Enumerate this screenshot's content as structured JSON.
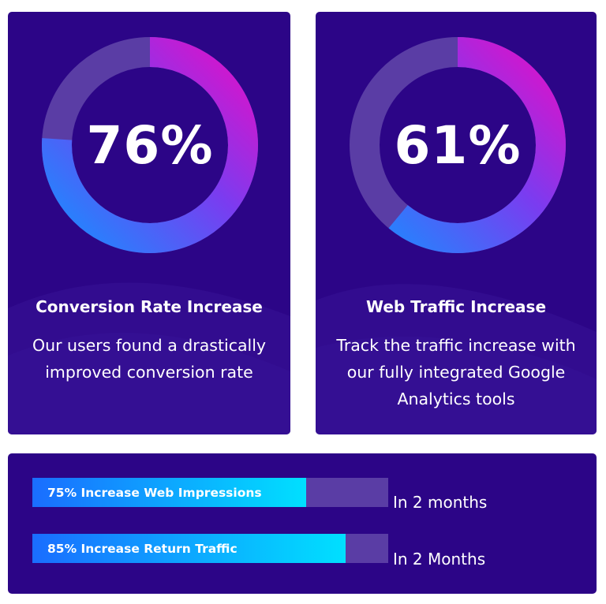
{
  "stats": [
    {
      "value_text": "76%",
      "percent": 76,
      "title": "Conversion Rate Increase",
      "description": "Our users found a drastically improved conversion rate"
    },
    {
      "value_text": "61%",
      "percent": 61,
      "title": "Web Traffic Increase",
      "description": "Track the traffic increase with our fully integrated Google Analytics tools"
    }
  ],
  "progress": [
    {
      "label": "75% Increase Web Impressions",
      "percent": 75,
      "note": "In 2 months"
    },
    {
      "label": "85% Increase Return Traffic",
      "percent": 85,
      "note": "In 2 Months"
    }
  ],
  "colors": {
    "card_background": "#2c0587",
    "ring_track": "#5a3da5",
    "ring_gradient_start": "#1a8cff",
    "ring_gradient_end": "#e010c8",
    "bar_gradient_start": "#1a6dff",
    "bar_gradient_end": "#00e0ff",
    "text": "#ffffff"
  }
}
